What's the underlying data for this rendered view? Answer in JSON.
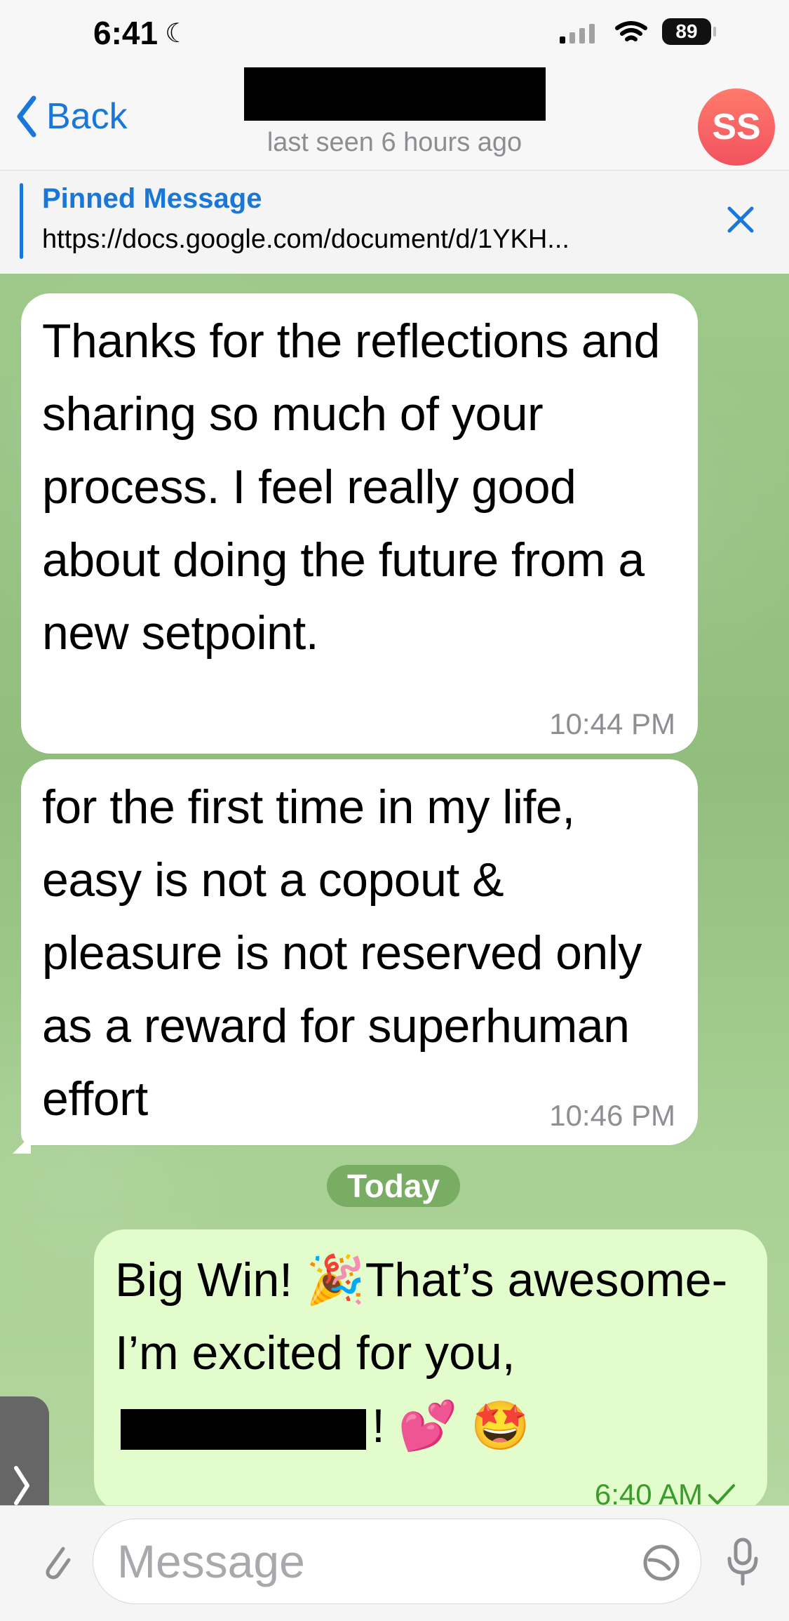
{
  "status": {
    "time": "6:41",
    "battery": "89"
  },
  "header": {
    "back_label": "Back",
    "last_seen": "last seen 6 hours ago",
    "avatar_initials": "SS"
  },
  "pinned": {
    "title": "Pinned Message",
    "text": "https://docs.google.com/document/d/1YKH..."
  },
  "messages": [
    {
      "text": "Thanks for the reflections and sharing so much of your process. I feel really good about doing the future from a new setpoint.",
      "time": "10:44 PM"
    },
    {
      "text": "for the first time in my life, easy is not a copout & pleasure is not reserved only as a reward for superhuman effort",
      "time": "10:46 PM"
    },
    {
      "date_label": "Today"
    },
    {
      "text_before": "Big Win! 🎉That’s awesome- I’m excited for you,",
      "text_after": "! 💕 🤩",
      "time": "6:40 AM"
    }
  ],
  "composer": {
    "placeholder": "Message"
  }
}
